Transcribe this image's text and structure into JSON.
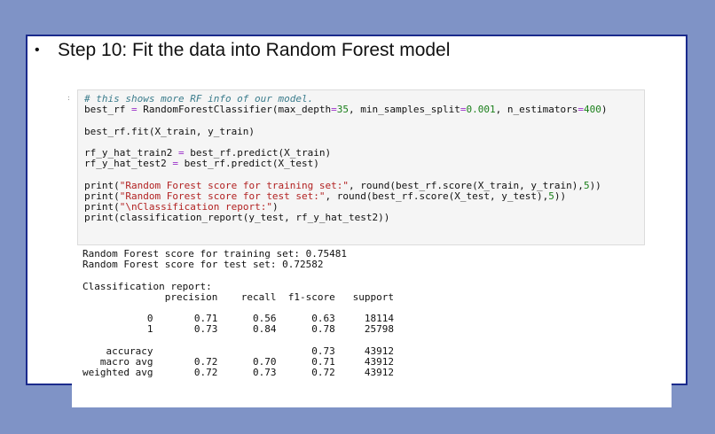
{
  "slide": {
    "bullet": "•",
    "title": "Step 10: Fit the data into Random Forest model"
  },
  "notebook": {
    "prompt": ":",
    "code_lines": [
      "# this shows more RF info of our model.",
      "best_rf = RandomForestClassifier(max_depth=35, min_samples_split=0.001, n_estimators=400)",
      "",
      "best_rf.fit(X_train, y_train)",
      "",
      "rf_y_hat_train2 = best_rf.predict(X_train)",
      "rf_y_hat_test2 = best_rf.predict(X_test)",
      "",
      "print(\"Random Forest score for training set:\", round(best_rf.score(X_train, y_train),5))",
      "print(\"Random Forest score for test set:\", round(best_rf.score(X_test, y_test),5))",
      "print(\"\\nClassification report:\")",
      "print(classification_report(y_test, rf_y_hat_test2))"
    ],
    "output_lines": [
      "Random Forest score for training set: 0.75481",
      "Random Forest score for test set: 0.72582",
      "",
      "Classification report:",
      "              precision    recall  f1-score   support",
      "",
      "           0       0.71      0.56      0.63     18114",
      "           1       0.73      0.84      0.78     25798",
      "",
      "    accuracy                           0.73     43912",
      "   macro avg       0.72      0.70      0.71     43912",
      "weighted avg       0.72      0.73      0.72     43912"
    ]
  },
  "colors": {
    "background": "#7f93c6",
    "slide_border": "#1a2a8c",
    "comment": "#3b7c8c",
    "string": "#b22222",
    "number": "#1a7f1a"
  }
}
